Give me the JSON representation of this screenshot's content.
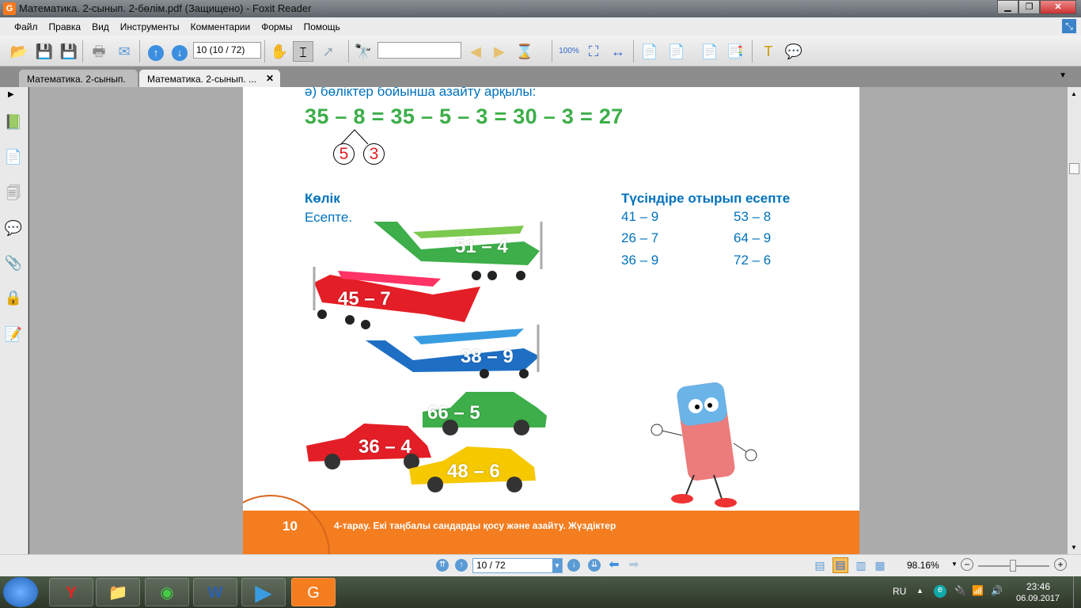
{
  "window": {
    "title": "Математика. 2-сынып. 2-бөлім.pdf (Защищено) - Foxit Reader",
    "app_icon": "G"
  },
  "menu": [
    "Файл",
    "Правка",
    "Вид",
    "Инструменты",
    "Комментарии",
    "Формы",
    "Помощь"
  ],
  "toolbar": {
    "page_field": "10 (10 / 72)",
    "search_placeholder": ""
  },
  "tabs": [
    {
      "label": "Математика. 2-сынып. ...",
      "active": false
    },
    {
      "label": "Математика. 2-сынып. ...",
      "active": true,
      "close": "✕"
    }
  ],
  "page": {
    "subtitle": "ә)  бөліктер бойынша азайту арқылы:",
    "equation": "35 – 8 = 35 – 5 – 3 = 30 – 3 = 27",
    "parts": [
      "5",
      "3"
    ],
    "section_left": {
      "title": "Көлік",
      "instruction": "Есепте."
    },
    "vehicles": [
      {
        "type": "plane",
        "color": "#3dae49",
        "label": "51 – 4"
      },
      {
        "type": "plane",
        "color": "#e41e26",
        "label": "45 – 7"
      },
      {
        "type": "plane",
        "color": "#1e6fc4",
        "label": "38 – 9"
      },
      {
        "type": "car",
        "color": "#3dae49",
        "label": "66 – 5"
      },
      {
        "type": "car",
        "color": "#e41e26",
        "label": "36 – 4"
      },
      {
        "type": "car",
        "color": "#f5c800",
        "label": "48 – 6"
      }
    ],
    "section_right": {
      "title": "Түсіндіре отырып есепте",
      "exercises": [
        "41 – 9",
        "53 – 8",
        "26 – 7",
        "64 – 9",
        "36 – 9",
        "72 – 6"
      ]
    },
    "footer": {
      "page_number": "10",
      "text": "4-тарау. Екі таңбалы сандарды қосу және азайту. Жүздіктер"
    }
  },
  "statusbar": {
    "page_select": "10 / 72",
    "zoom": "98.16%"
  },
  "taskbar": {
    "language": "RU",
    "time": "23:46",
    "date": "06.09.2017"
  }
}
